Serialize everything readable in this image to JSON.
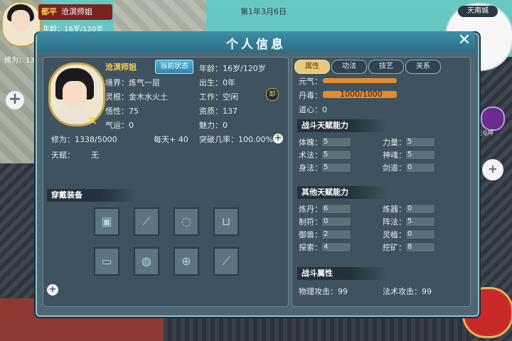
{
  "hud": {
    "title": "都平",
    "name": "沧溟师姐",
    "age_text": "年龄：16岁/120岁",
    "cultivation_text": "修为：13",
    "plus_symbol": "+"
  },
  "world": {
    "date": "第1年3月6日",
    "city": "天南城",
    "side_icon_label": "元屯坪",
    "side_arrow": "+"
  },
  "dialog": {
    "title": "个人信息",
    "close_symbol": "✕"
  },
  "character": {
    "name": "沧溟师姐",
    "status_button": "当前状态",
    "gender": "女",
    "realm": "境界：炼气一层",
    "spirit_root": "灵根：金木水火土",
    "comprehension": "悟性：75",
    "luck": "气运：0",
    "age": "年龄：16岁/120岁",
    "birth": "出生：0年",
    "job": "工作：空闲",
    "aptitude": "资质：137",
    "charm": "魅力：0",
    "unload_icon": "卸",
    "cultivation": "修为：1338/5000",
    "daily": "每天+ 40",
    "breakthrough": "突破几率：100.00%",
    "talent_label": "天赋：",
    "talent_value": "无",
    "plus_symbol": "+"
  },
  "equipment": {
    "title": "穿戴装备",
    "slots": [
      "robe-icon",
      "sword-icon",
      "empty-slot-icon",
      "boots-icon",
      "scroll-icon",
      "orb-icon",
      "talisman-icon",
      "blade-icon"
    ]
  },
  "tabs": [
    "属性",
    "功法",
    "技艺",
    "关系"
  ],
  "attributes": {
    "yuanqi_label": "元气：",
    "dandu_label": "丹毒：",
    "dandu_value": "1000/1000",
    "dandu_fraction": 1.0,
    "yuanqi_fraction": 1.0,
    "daoxin": "道心：0"
  },
  "battle_talent": {
    "title": "战斗天赋能力",
    "stats": [
      {
        "label": "体魄：",
        "value": "5"
      },
      {
        "label": "力量：",
        "value": "5"
      },
      {
        "label": "术法：",
        "value": "5"
      },
      {
        "label": "神魂：",
        "value": "5"
      },
      {
        "label": "身法：",
        "value": "5"
      },
      {
        "label": "剑道：",
        "value": "0"
      }
    ]
  },
  "other_talent": {
    "title": "其他天赋能力",
    "stats": [
      {
        "label": "炼丹：",
        "value": "6"
      },
      {
        "label": "炼器：",
        "value": "0"
      },
      {
        "label": "制符：",
        "value": "0"
      },
      {
        "label": "阵法：",
        "value": "5"
      },
      {
        "label": "御兽：",
        "value": "2"
      },
      {
        "label": "灵植：",
        "value": "0"
      },
      {
        "label": "探索：",
        "value": "4"
      },
      {
        "label": "挖矿：",
        "value": "8"
      }
    ]
  },
  "battle_attr": {
    "title": "战斗属性",
    "phys_attack": "物理攻击：99",
    "magic_attack": "法术攻击：99"
  },
  "colors": {
    "accent_gold": "#ffd24a",
    "bar_orange": "#e68a2e",
    "panel_bg": "#3f525f",
    "header_teal": "#2a6e86"
  }
}
